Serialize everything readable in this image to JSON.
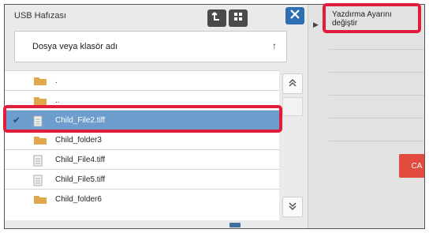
{
  "left": {
    "title": "USB Hafızası",
    "search_label": "Dosya veya klasör adı",
    "sort_icon": "↑"
  },
  "files": [
    {
      "name": ".",
      "type": "folder",
      "selected": false
    },
    {
      "name": "..",
      "type": "folder",
      "selected": false
    },
    {
      "name": "Child_File2.tiff",
      "type": "file",
      "selected": true
    },
    {
      "name": "Child_folder3",
      "type": "folder",
      "selected": false
    },
    {
      "name": "Child_File4.tiff",
      "type": "file",
      "selected": false
    },
    {
      "name": "Child_File5.tiff",
      "type": "file",
      "selected": false
    },
    {
      "name": "Child_folder6",
      "type": "folder",
      "selected": false
    }
  ],
  "right": {
    "menu_item": "Yazdırma Ayarını değiştir",
    "ca_label": "CA"
  },
  "colors": {
    "highlight": "#e11d3c",
    "selected_row": "#6d9dcc",
    "close_button": "#2d6fb2",
    "ca_button": "#e14a3d"
  }
}
